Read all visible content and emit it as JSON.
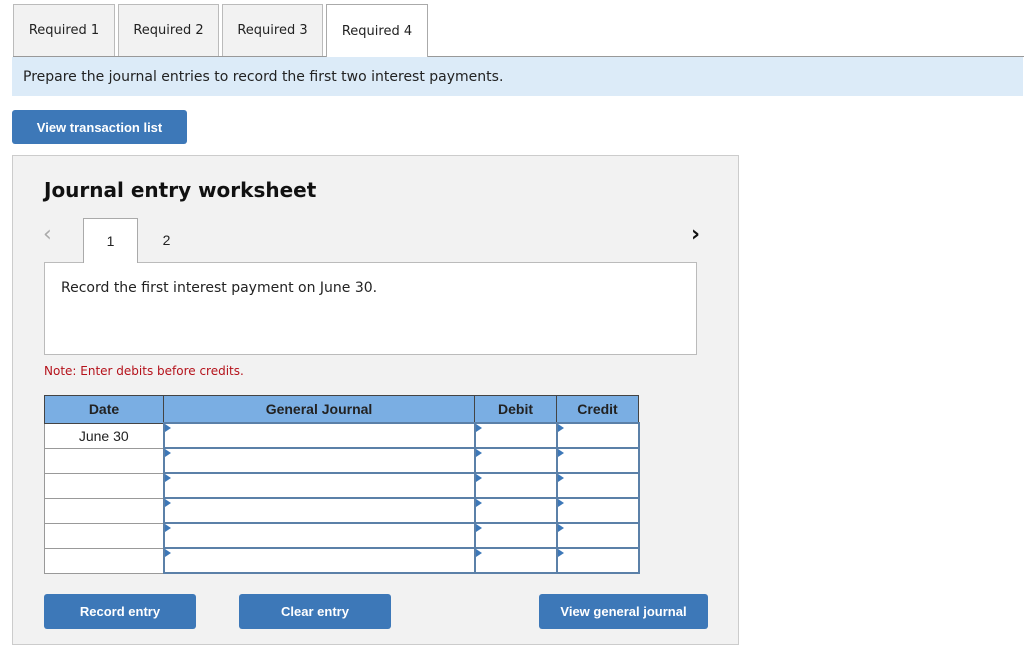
{
  "tabs": [
    {
      "label": "Required 1",
      "active": false
    },
    {
      "label": "Required 2",
      "active": false
    },
    {
      "label": "Required 3",
      "active": false
    },
    {
      "label": "Required 4",
      "active": true
    }
  ],
  "instruction": "Prepare the journal entries to record the first two interest payments.",
  "view_transaction_list": "View transaction list",
  "worksheet": {
    "title": "Journal entry worksheet",
    "prev_icon": "chevron-left-icon",
    "next_icon": "chevron-right-icon",
    "pages": [
      "1",
      "2"
    ],
    "active_page": "1",
    "description": "Record the first interest payment on June 30.",
    "note": "Note: Enter debits before credits.",
    "columns": [
      "Date",
      "General Journal",
      "Debit",
      "Credit"
    ],
    "rows": [
      {
        "date": "June 30",
        "account": "",
        "debit": "",
        "credit": ""
      },
      {
        "date": "",
        "account": "",
        "debit": "",
        "credit": ""
      },
      {
        "date": "",
        "account": "",
        "debit": "",
        "credit": ""
      },
      {
        "date": "",
        "account": "",
        "debit": "",
        "credit": ""
      },
      {
        "date": "",
        "account": "",
        "debit": "",
        "credit": ""
      },
      {
        "date": "",
        "account": "",
        "debit": "",
        "credit": ""
      }
    ],
    "buttons": {
      "record": "Record entry",
      "clear": "Clear entry",
      "view_journal": "View general journal"
    }
  }
}
